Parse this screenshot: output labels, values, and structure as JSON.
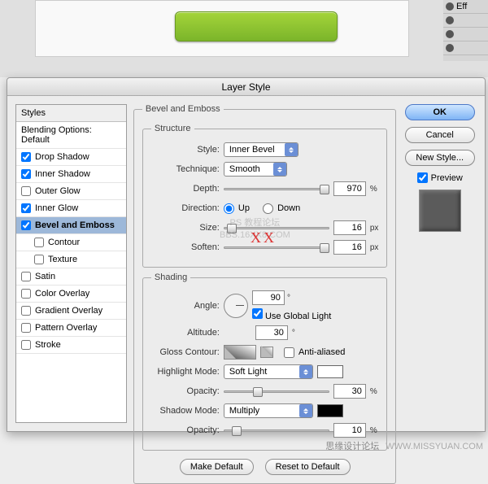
{
  "dialog_title": "Layer Style",
  "sidebar": {
    "header": "Styles",
    "blending": "Blending Options: Default",
    "items": [
      {
        "label": "Drop Shadow",
        "checked": true
      },
      {
        "label": "Inner Shadow",
        "checked": true
      },
      {
        "label": "Outer Glow",
        "checked": false
      },
      {
        "label": "Inner Glow",
        "checked": true
      },
      {
        "label": "Bevel and Emboss",
        "checked": true,
        "selected": true
      },
      {
        "label": "Contour",
        "checked": false,
        "indent": true
      },
      {
        "label": "Texture",
        "checked": false,
        "indent": true
      },
      {
        "label": "Satin",
        "checked": false
      },
      {
        "label": "Color Overlay",
        "checked": false
      },
      {
        "label": "Gradient Overlay",
        "checked": false
      },
      {
        "label": "Pattern Overlay",
        "checked": false
      },
      {
        "label": "Stroke",
        "checked": false
      }
    ]
  },
  "panel": {
    "title": "Bevel and Emboss",
    "structure": {
      "legend": "Structure",
      "style_label": "Style:",
      "style_value": "Inner Bevel",
      "technique_label": "Technique:",
      "technique_value": "Smooth",
      "depth_label": "Depth:",
      "depth_value": "970",
      "depth_unit": "%",
      "direction_label": "Direction:",
      "direction_up": "Up",
      "direction_down": "Down",
      "size_label": "Size:",
      "size_value": "16",
      "size_unit": "px",
      "soften_label": "Soften:",
      "soften_value": "16",
      "soften_unit": "px"
    },
    "shading": {
      "legend": "Shading",
      "angle_label": "Angle:",
      "angle_value": "90",
      "angle_unit": "°",
      "global_light": "Use Global Light",
      "altitude_label": "Altitude:",
      "altitude_value": "30",
      "altitude_unit": "°",
      "gloss_label": "Gloss Contour:",
      "antialiased": "Anti-aliased",
      "highlight_label": "Highlight Mode:",
      "highlight_value": "Soft Light",
      "highlight_opacity_label": "Opacity:",
      "highlight_opacity_value": "30",
      "highlight_opacity_unit": "%",
      "shadow_label": "Shadow Mode:",
      "shadow_value": "Multiply",
      "shadow_opacity_label": "Opacity:",
      "shadow_opacity_value": "10",
      "shadow_opacity_unit": "%"
    },
    "make_default": "Make Default",
    "reset_default": "Reset to Default"
  },
  "buttons": {
    "ok": "OK",
    "cancel": "Cancel",
    "new_style": "New Style...",
    "preview": "Preview"
  },
  "right_panel_label": "Eff",
  "watermark": {
    "xx": "XX",
    "line1": "PS 教程论坛",
    "line2": "BBS.16XX8.COM"
  },
  "footer": {
    "cn": "思缘设计论坛",
    "url": "WWW.MISSYUAN.COM"
  }
}
